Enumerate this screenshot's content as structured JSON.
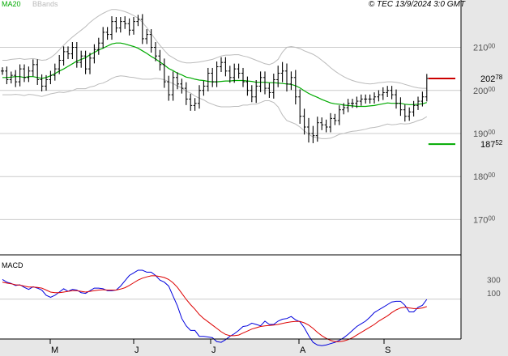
{
  "header": {
    "ma_label": "MA20",
    "bb_label": "BBands",
    "copyright": "© TEC 13/9/2024 3:0 GMT"
  },
  "colors": {
    "background": "#ffffff",
    "axis_panel": "#e7e7e7",
    "grid": "#cccccc",
    "frame": "#000000",
    "bars": "#000000",
    "ma20": "#00aa00",
    "bbands": "#bbbbbb",
    "macd": "#0000dd",
    "signal": "#dd0000",
    "resistance": "#cc0000",
    "support": "#00aa00"
  },
  "chart_data": [
    {
      "type": "bar",
      "subtype": "ohlc",
      "overlays": [
        "MA20",
        "BBands"
      ],
      "y_ticks": [
        {
          "value": 17000,
          "main": "170",
          "sub": "00"
        },
        {
          "value": 18000,
          "main": "180",
          "sub": "00"
        },
        {
          "value": 19000,
          "main": "190",
          "sub": "00"
        },
        {
          "value": 20000,
          "main": "200",
          "sub": "00"
        },
        {
          "value": 21000,
          "main": "210",
          "sub": "00"
        }
      ],
      "ylim": [
        16200,
        22100
      ],
      "x_month_labels": [
        "M",
        "J",
        "J",
        "A",
        "S"
      ],
      "levels": [
        {
          "name": "resistance",
          "value": 20278,
          "main": "202",
          "sub": "78"
        },
        {
          "name": "support",
          "value": 18752,
          "main": "187",
          "sub": "52"
        }
      ],
      "close": [
        20450,
        20250,
        20350,
        20200,
        20500,
        20300,
        20450,
        20600,
        20250,
        20100,
        20250,
        20350,
        20500,
        20700,
        20900,
        20850,
        21000,
        20650,
        20800,
        20500,
        20750,
        20950,
        21100,
        21350,
        21300,
        21600,
        21450,
        21600,
        21550,
        21400,
        21600,
        21650,
        21200,
        21300,
        21000,
        20800,
        20600,
        20200,
        19900,
        20300,
        20150,
        20050,
        19800,
        19650,
        19700,
        20000,
        20100,
        20400,
        20200,
        20550,
        20650,
        20450,
        20300,
        20500,
        20400,
        20200,
        20000,
        19850,
        20100,
        20300,
        20050,
        19950,
        20250,
        20400,
        20450,
        20150,
        20300,
        19850,
        19400,
        19150,
        19000,
        18950,
        19250,
        19200,
        19150,
        19350,
        19300,
        19550,
        19600,
        19700,
        19700,
        19750,
        19800,
        19800,
        19800,
        19850,
        19900,
        19950,
        20000,
        19900,
        19700,
        19550,
        19400,
        19500,
        19650,
        19750,
        19850,
        20278
      ],
      "range": [
        250,
        300,
        250,
        350,
        300,
        300,
        300,
        350,
        350,
        350,
        300,
        300,
        350,
        350,
        350,
        350,
        350,
        350,
        350,
        350,
        350,
        350,
        350,
        350,
        350,
        350,
        300,
        300,
        350,
        350,
        300,
        300,
        350,
        350,
        350,
        350,
        400,
        400,
        400,
        400,
        350,
        350,
        400,
        350,
        350,
        350,
        350,
        350,
        350,
        350,
        350,
        350,
        350,
        350,
        350,
        350,
        350,
        350,
        400,
        400,
        400,
        350,
        400,
        500,
        600,
        500,
        400,
        500,
        500,
        500,
        600,
        500,
        400,
        350,
        350,
        350,
        300,
        300,
        300,
        300,
        300,
        300,
        300,
        300,
        300,
        300,
        300,
        350,
        300,
        300,
        350,
        400,
        350,
        300,
        300,
        300,
        350,
        300
      ],
      "ma20": [
        20300,
        20300,
        20310,
        20320,
        20320,
        20300,
        20320,
        20320,
        20300,
        20280,
        20300,
        20340,
        20390,
        20450,
        20500,
        20560,
        20620,
        20680,
        20720,
        20760,
        20830,
        20880,
        20940,
        20980,
        21030,
        21080,
        21100,
        21100,
        21080,
        21050,
        21020,
        20980,
        20920,
        20860,
        20790,
        20730,
        20660,
        20590,
        20510,
        20460,
        20400,
        20360,
        20310,
        20290,
        20260,
        20240,
        20230,
        20210,
        20200,
        20200,
        20210,
        20220,
        20220,
        20230,
        20230,
        20230,
        20220,
        20210,
        20190,
        20190,
        20190,
        20180,
        20180,
        20170,
        20160,
        20150,
        20140,
        20110,
        20060,
        19990,
        19930,
        19880,
        19840,
        19790,
        19750,
        19710,
        19690,
        19680,
        19660,
        19650,
        19640,
        19630,
        19630,
        19630,
        19640,
        19650,
        19670,
        19690,
        19710,
        19700,
        19700,
        19700,
        19680,
        19670,
        19670,
        19680,
        19690,
        19720
      ],
      "bb_upper": [
        20700,
        20700,
        20720,
        20730,
        20740,
        20720,
        20730,
        20740,
        20720,
        20700,
        20710,
        20760,
        20840,
        20940,
        21050,
        21150,
        21240,
        21320,
        21400,
        21480,
        21580,
        21660,
        21730,
        21790,
        21840,
        21880,
        21880,
        21860,
        21830,
        21790,
        21740,
        21680,
        21580,
        21460,
        21320,
        21180,
        21050,
        20930,
        20820,
        20760,
        20700,
        20660,
        20640,
        20640,
        20650,
        20660,
        20680,
        20700,
        20720,
        20760,
        20800,
        20820,
        20820,
        20830,
        20830,
        20800,
        20780,
        20740,
        20700,
        20660,
        20620,
        20600,
        20640,
        20720,
        20890,
        21000,
        21020,
        21000,
        20970,
        20920,
        20880,
        20840,
        20780,
        20700,
        20620,
        20530,
        20450,
        20380,
        20320,
        20270,
        20230,
        20200,
        20180,
        20160,
        20150,
        20160,
        20180,
        20190,
        20200,
        20200,
        20190,
        20170,
        20140,
        20110,
        20080,
        20060,
        20050,
        20050
      ],
      "bb_lower": [
        19900,
        19900,
        19900,
        19910,
        19900,
        19880,
        19910,
        19900,
        19880,
        19860,
        19890,
        19920,
        19940,
        19960,
        19950,
        19970,
        20000,
        20040,
        20040,
        20040,
        20080,
        20100,
        20150,
        20170,
        20220,
        20280,
        20320,
        20340,
        20330,
        20310,
        20300,
        20280,
        20260,
        20260,
        20260,
        20280,
        20270,
        20250,
        20200,
        20160,
        20100,
        20060,
        19980,
        19940,
        19870,
        19820,
        19780,
        19720,
        19680,
        19640,
        19620,
        19620,
        19620,
        19630,
        19630,
        19660,
        19660,
        19680,
        19680,
        19720,
        19760,
        19760,
        19720,
        19620,
        19430,
        19300,
        19260,
        19220,
        19150,
        19060,
        18980,
        18920,
        18900,
        18880,
        18880,
        18890,
        18930,
        18980,
        19000,
        19030,
        19050,
        19060,
        19080,
        19100,
        19130,
        19140,
        19160,
        19190,
        19220,
        19200,
        19210,
        19230,
        19220,
        19230,
        19260,
        19300,
        19330,
        19390
      ]
    },
    {
      "type": "line",
      "title": "MACD",
      "y_ticks": [
        {
          "value": 100,
          "main": "100",
          "sub": ""
        },
        {
          "value": 300,
          "main": "300",
          "sub": ""
        }
      ],
      "ylim": [
        -600,
        660
      ],
      "series": [
        {
          "name": "MACD",
          "values": [
            300,
            260,
            240,
            210,
            220,
            180,
            150,
            190,
            170,
            140,
            60,
            30,
            60,
            110,
            160,
            120,
            150,
            140,
            100,
            90,
            130,
            170,
            170,
            160,
            130,
            130,
            140,
            200,
            280,
            360,
            400,
            440,
            440,
            410,
            410,
            360,
            290,
            260,
            200,
            50,
            -100,
            -290,
            -400,
            -470,
            -470,
            -560,
            -560,
            -570,
            -580,
            -640,
            -650,
            -610,
            -560,
            -520,
            -470,
            -410,
            -400,
            -360,
            -380,
            -400,
            -330,
            -380,
            -380,
            -330,
            -300,
            -290,
            -260,
            -310,
            -340,
            -430,
            -550,
            -650,
            -690,
            -700,
            -690,
            -670,
            -650,
            -620,
            -580,
            -530,
            -470,
            -410,
            -370,
            -330,
            -270,
            -200,
            -160,
            -120,
            -80,
            -40,
            -30,
            -30,
            -90,
            -190,
            -190,
            -120,
            -90,
            0
          ]
        },
        {
          "name": "Signal",
          "values": [
            260,
            245,
            235,
            220,
            215,
            200,
            185,
            185,
            180,
            170,
            140,
            110,
            100,
            100,
            110,
            120,
            130,
            130,
            120,
            110,
            120,
            130,
            140,
            145,
            140,
            140,
            140,
            155,
            175,
            210,
            250,
            290,
            320,
            340,
            355,
            355,
            345,
            330,
            300,
            250,
            180,
            90,
            0,
            -80,
            -150,
            -230,
            -290,
            -340,
            -390,
            -440,
            -490,
            -530,
            -550,
            -550,
            -540,
            -510,
            -480,
            -450,
            -430,
            -410,
            -400,
            -395,
            -390,
            -380,
            -365,
            -350,
            -340,
            -335,
            -335,
            -355,
            -390,
            -440,
            -500,
            -550,
            -590,
            -620,
            -640,
            -640,
            -630,
            -610,
            -580,
            -540,
            -500,
            -460,
            -420,
            -380,
            -330,
            -290,
            -250,
            -200,
            -160,
            -130,
            -120,
            -130,
            -140,
            -140,
            -130,
            -110
          ]
        }
      ]
    }
  ]
}
